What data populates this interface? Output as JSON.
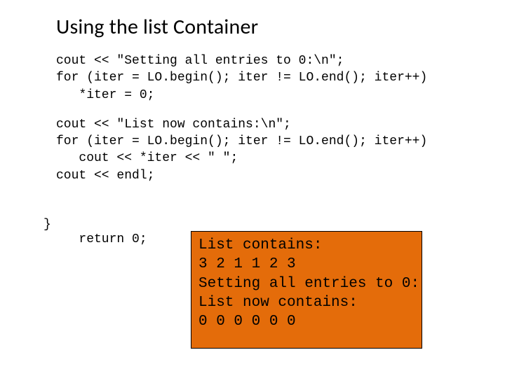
{
  "title": "Using the list Container",
  "code": {
    "block1": "cout << \"Setting all entries to 0:\\n\";\nfor (iter = LO.begin(); iter != LO.end(); iter++)\n   *iter = 0;",
    "block2": "cout << \"List now contains:\\n\";\nfor (iter = LO.begin(); iter != LO.end(); iter++)\n   cout << *iter << \" \";\ncout << endl;",
    "return_line": "   return 0;",
    "close_brace": "}"
  },
  "output": "List contains:\n3 2 1 1 2 3\nSetting all entries to 0:\nList now contains:\n0 0 0 0 0 0"
}
